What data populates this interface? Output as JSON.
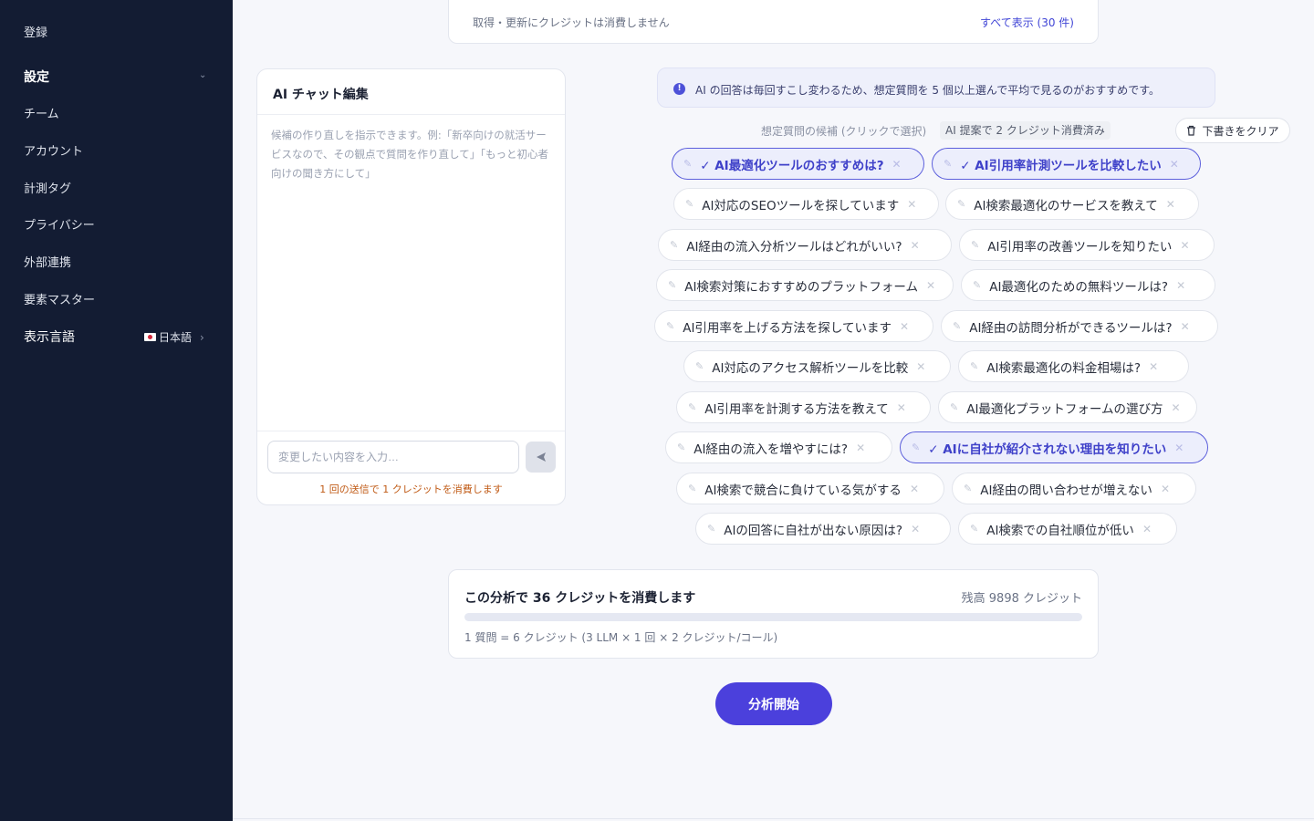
{
  "sidebar": {
    "register": "登録",
    "settings_label": "設定",
    "items": [
      "チーム",
      "アカウント",
      "計測タグ",
      "プライバシー",
      "外部連携",
      "要素マスター"
    ],
    "language_label": "表示言語",
    "language_value": "日本語"
  },
  "top_card": {
    "note": "取得・更新にクレジットは消費しません",
    "view_all": "すべて表示 (30 件)"
  },
  "chat": {
    "title": "AI チャット編集",
    "hint": "候補の作り直しを指示できます。例:「新卒向けの就活サービスなので、その観点で質問を作り直して」「もっと初心者向けの聞き方にして」",
    "input_placeholder": "変更したい内容を入力…",
    "cost_note": "1 回の送信で 1 クレジットを消費します"
  },
  "suggestions": {
    "info": "AI の回答は毎回すこし変わるため、想定質問を 5 個以上選んで平均で見るのがおすすめです。",
    "label": "想定質問の候補 (クリックで選択)",
    "badge": "AI 提案で 2 クレジット消費済み",
    "clear_label": "下書きをクリア",
    "chips": [
      {
        "text": "✓ AI最適化ツールのおすすめは?",
        "selected": true
      },
      {
        "text": "✓ AI引用率計測ツールを比較したい",
        "selected": true
      },
      {
        "text": "AI対応のSEOツールを探しています",
        "selected": false
      },
      {
        "text": "AI検索最適化のサービスを教えて",
        "selected": false
      },
      {
        "text": "AI経由の流入分析ツールはどれがいい?",
        "selected": false
      },
      {
        "text": "AI引用率の改善ツールを知りたい",
        "selected": false
      },
      {
        "text": "AI検索対策におすすめのプラットフォーム",
        "selected": false
      },
      {
        "text": "AI最適化のための無料ツールは?",
        "selected": false
      },
      {
        "text": "AI引用率を上げる方法を探しています",
        "selected": false
      },
      {
        "text": "AI経由の訪問分析ができるツールは?",
        "selected": false
      },
      {
        "text": "AI対応のアクセス解析ツールを比較",
        "selected": false
      },
      {
        "text": "AI検索最適化の料金相場は?",
        "selected": false
      },
      {
        "text": "AI引用率を計測する方法を教えて",
        "selected": false
      },
      {
        "text": "AI最適化プラットフォームの選び方",
        "selected": false
      },
      {
        "text": "AI経由の流入を増やすには?",
        "selected": false
      },
      {
        "text": "✓ AIに自社が紹介されない理由を知りたい",
        "selected": true
      },
      {
        "text": "AI検索で競合に負けている気がする",
        "selected": false
      },
      {
        "text": "AI経由の問い合わせが増えない",
        "selected": false
      },
      {
        "text": "AIの回答に自社が出ない原因は?",
        "selected": false
      },
      {
        "text": "AI検索での自社順位が低い",
        "selected": false
      }
    ]
  },
  "cost": {
    "headline": "この分析で 36 クレジットを消費します",
    "balance": "残高 9898 クレジット",
    "formula": "1 質問 = 6 クレジット (3 LLM × 1 回 × 2 クレジット/コール)"
  },
  "start_label": "分析開始",
  "colors": {
    "accent": "#4b40dc",
    "sidebar": "#131c33"
  }
}
